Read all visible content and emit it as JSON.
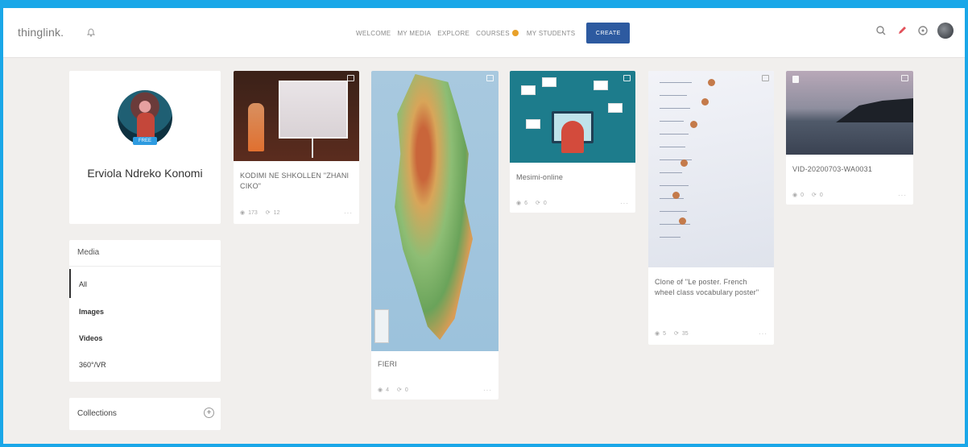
{
  "topbar": {
    "logo": "thinglink.",
    "nav": [
      {
        "label": "WELCOME"
      },
      {
        "label": "MY MEDIA"
      },
      {
        "label": "EXPLORE"
      },
      {
        "label": "COURSES"
      },
      {
        "label": "MY STUDENTS"
      }
    ],
    "create_label": "CREATE"
  },
  "profile": {
    "name": "Erviola Ndreko Konomi",
    "badge": "FREE"
  },
  "media_filter": {
    "title": "Media",
    "items": [
      {
        "label": "All",
        "active": true
      },
      {
        "label": "Images"
      },
      {
        "label": "Videos"
      },
      {
        "label": "360°/VR"
      }
    ]
  },
  "collections": {
    "label": "Collections"
  },
  "cards": [
    {
      "title": "KODIMI NE SHKOLLEN \"ZHANI CIKO\"",
      "views": "173",
      "shares": "12"
    },
    {
      "title": "FIERI",
      "views": "4",
      "shares": "0"
    },
    {
      "title": "Mesimi-online",
      "views": "6",
      "shares": "0"
    },
    {
      "title": "Clone of \"Le poster. French wheel class vocabulary poster\"",
      "views": "5",
      "shares": "35"
    },
    {
      "title": "VID-20200703-WA0031",
      "views": "0",
      "shares": "0"
    }
  ],
  "colors": {
    "frame": "#1aa7e8",
    "create_button": "#2d5aa0",
    "free_badge": "#2e9be0",
    "courses_dot": "#e8a12a"
  }
}
